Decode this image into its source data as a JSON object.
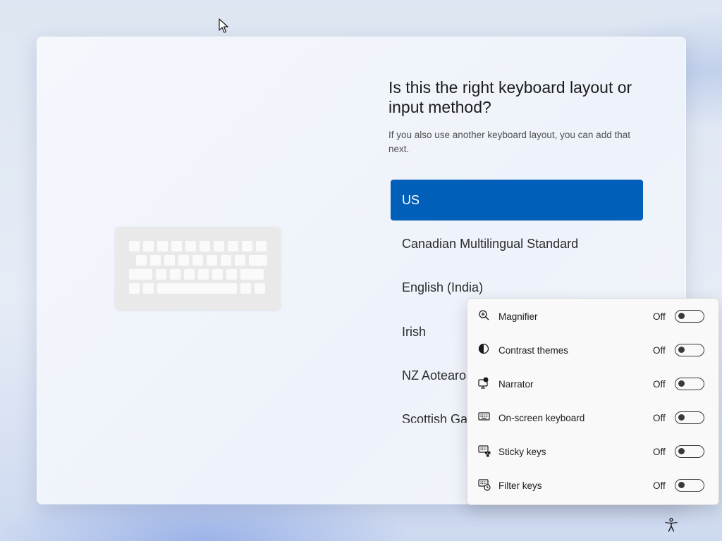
{
  "setup": {
    "heading": "Is this the right keyboard layout or input method?",
    "subtext": "If you also use another keyboard layout, you can add that next.",
    "layouts": [
      {
        "label": "US",
        "selected": true
      },
      {
        "label": "Canadian Multilingual Standard",
        "selected": false
      },
      {
        "label": "English (India)",
        "selected": false
      },
      {
        "label": "Irish",
        "selected": false
      },
      {
        "label": "NZ Aotearoa",
        "selected": false
      },
      {
        "label": "Scottish Gaelic",
        "selected": false
      }
    ]
  },
  "accessibility_menu": {
    "items": [
      {
        "label": "Magnifier",
        "state": "Off",
        "icon": "magnifier-icon"
      },
      {
        "label": "Contrast themes",
        "state": "Off",
        "icon": "contrast-icon"
      },
      {
        "label": "Narrator",
        "state": "Off",
        "icon": "narrator-icon"
      },
      {
        "label": "On-screen keyboard",
        "state": "Off",
        "icon": "keyboard-icon"
      },
      {
        "label": "Sticky keys",
        "state": "Off",
        "icon": "sticky-keys-icon"
      },
      {
        "label": "Filter keys",
        "state": "Off",
        "icon": "filter-keys-icon"
      }
    ]
  },
  "colors": {
    "accent": "#005fb8",
    "card_background": "#f2f5fb",
    "flyout_background": "#f9f9f9"
  }
}
